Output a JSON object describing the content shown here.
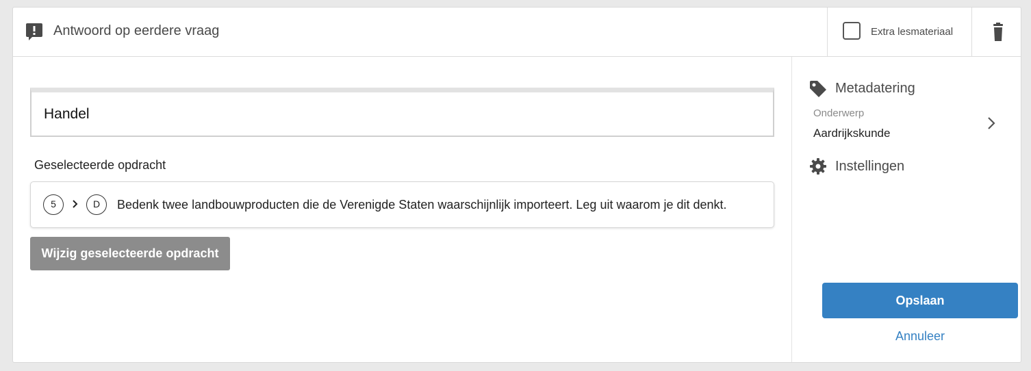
{
  "header": {
    "title": "Antwoord op eerdere vraag",
    "extra_material_label": "Extra lesmateriaal",
    "extra_material_checked": false
  },
  "main": {
    "title_value": "Handel",
    "selected_label": "Geselecteerde opdracht",
    "task": {
      "chapter": "5",
      "section": "D",
      "text": "Bedenk twee landbouwproducten die de Verenigde Staten waarschijnlijk importeert. Leg uit waarom je dit denkt."
    },
    "change_button": "Wijzig geselecteerde opdracht"
  },
  "sidebar": {
    "metadata_title": "Metadatering",
    "subject_label": "Onderwerp",
    "subject_value": "Aardrijkskunde",
    "settings_title": "Instellingen",
    "save_button": "Opslaan",
    "cancel_link": "Annuleer"
  },
  "colors": {
    "primary": "#3581c3",
    "disabled_button": "#8c8c8c",
    "icon": "#4a4a4a"
  },
  "icons": {
    "header": "comment-alert-icon",
    "delete": "trash-icon",
    "metadata": "tag-icon",
    "settings": "gear-icon",
    "chevron": "chevron-right-icon"
  }
}
